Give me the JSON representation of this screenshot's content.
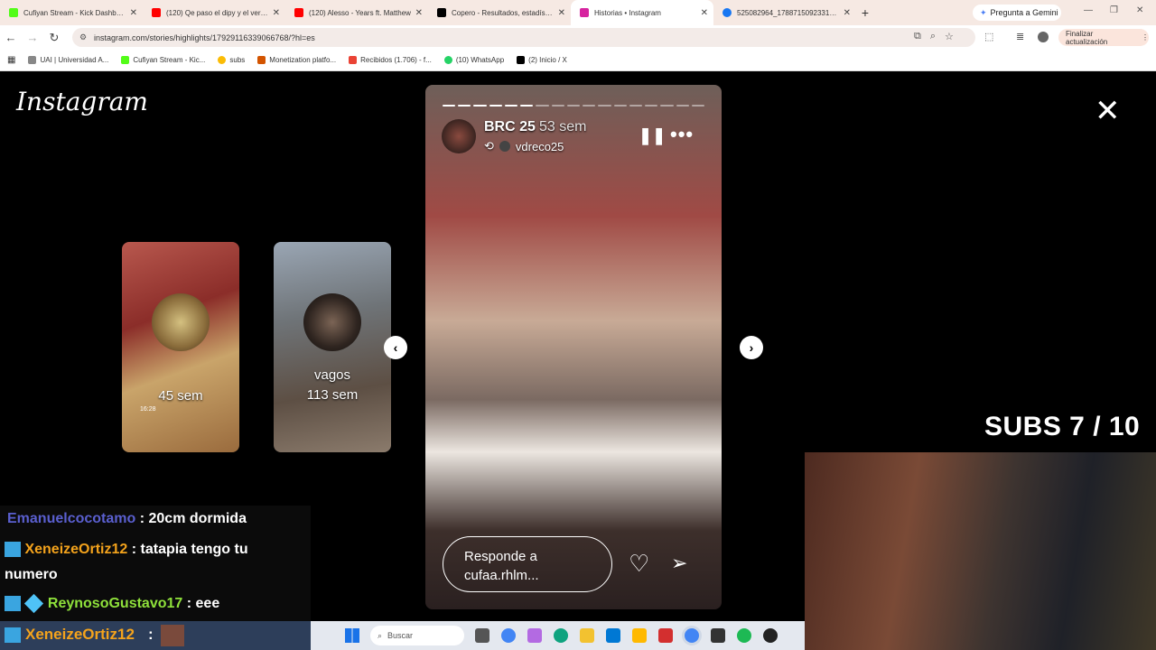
{
  "browser": {
    "tabs": [
      {
        "label": "Cufiyan Stream - Kick Dashboard",
        "color": "#53fc18"
      },
      {
        "label": "(120) Qe paso el dipy y el verdad",
        "color": "#ff0000"
      },
      {
        "label": "(120) Alesso - Years ft. Matthew",
        "color": "#ff0000"
      },
      {
        "label": "Copero - Resultados, estadísticas",
        "color": "#000000"
      },
      {
        "label": "Historias • Instagram",
        "color": "#d6249f"
      },
      {
        "label": "525082964_1788715092331999",
        "color": "#1877f2"
      }
    ],
    "new_tab": "+",
    "gemini_label": "Pregunta a Gemini",
    "url": "instagram.com/stories/highlights/17929116339066768/?hl=es",
    "update_label": "Finalizar actualización",
    "bookmarks": [
      {
        "label": "UAI | Universidad A...",
        "color": "#888888"
      },
      {
        "label": "Cufiyan Stream - Kic...",
        "color": "#53fc18"
      },
      {
        "label": "subs",
        "color": "#fbbc05"
      },
      {
        "label": "Monetization platfo...",
        "color": "#d35400"
      },
      {
        "label": "Recibidos (1.706) - f...",
        "color": "#ea4335"
      },
      {
        "label": "(10) WhatsApp",
        "color": "#25d366"
      },
      {
        "label": "(2) Inicio / X",
        "color": "#000000"
      }
    ]
  },
  "instagram": {
    "logo": "Instagram",
    "close_icon": "✕",
    "prev_cards": [
      {
        "name": "",
        "time": "45 sem",
        "small": "16:28"
      },
      {
        "name": "vagos",
        "time": "113 sem",
        "small": ""
      }
    ],
    "story": {
      "username": "BRC 25",
      "time": "53 sem",
      "repost_user": "vdreco25",
      "reply_placeholder_line1": "Responde a",
      "reply_placeholder_line2": "cufaa.rhlm...",
      "progress_segments_total": 17,
      "progress_segments_done": 6
    }
  },
  "overlay": {
    "subs_counter": "SUBS 7 / 10",
    "chat": [
      {
        "user": "Emanuelcocotamo",
        "text": ": 20cm dormida",
        "color": "#5a5fcf"
      },
      {
        "user": "XeneizeOrtiz12",
        "text": ": tatapia tengo tu",
        "text2": "numero",
        "color": "#f4a31c"
      },
      {
        "user": "ReynosoGustavo17",
        "text": ": eee",
        "color": "#8fe13b"
      },
      {
        "user": "XeneizeOrtiz12",
        "text": ":",
        "color": "#f4a31c"
      }
    ]
  },
  "taskbar": {
    "search_placeholder": "Buscar"
  }
}
